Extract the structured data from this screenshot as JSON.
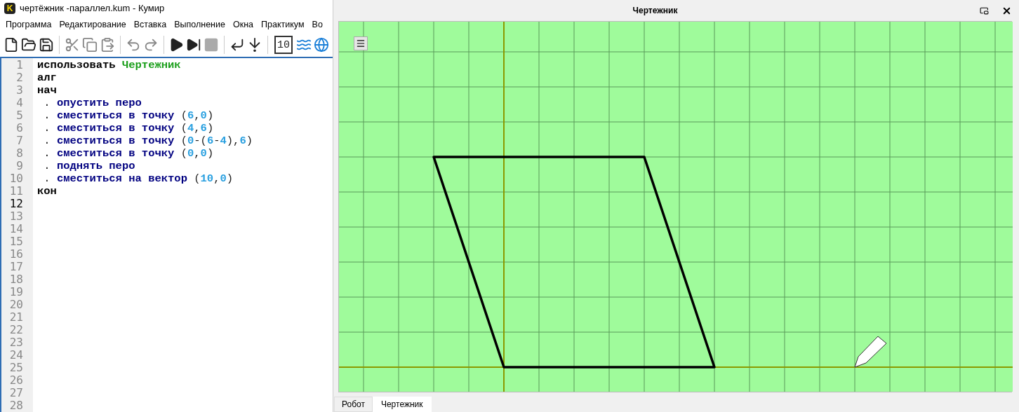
{
  "main_window": {
    "logo": "K",
    "title": "чертёжник -параллел.kum - Кумир"
  },
  "menu": [
    "Программа",
    "Редактирование",
    "Вставка",
    "Выполнение",
    "Окна",
    "Практикум",
    "Во"
  ],
  "toolbar": [
    {
      "kind": "new"
    },
    {
      "kind": "open"
    },
    {
      "kind": "save"
    },
    {
      "kind": "sep"
    },
    {
      "kind": "cut"
    },
    {
      "kind": "copy"
    },
    {
      "kind": "paste"
    },
    {
      "kind": "sep"
    },
    {
      "kind": "undo"
    },
    {
      "kind": "redo"
    },
    {
      "kind": "sep"
    },
    {
      "kind": "run"
    },
    {
      "kind": "step-run"
    },
    {
      "kind": "stop"
    },
    {
      "kind": "sep"
    },
    {
      "kind": "step-over"
    },
    {
      "kind": "step-into"
    },
    {
      "kind": "sep"
    },
    {
      "kind": "counter",
      "text": "10"
    },
    {
      "kind": "waves"
    },
    {
      "kind": "globe"
    }
  ],
  "editor": {
    "lines": [
      {
        "number": "1",
        "selected": false,
        "tokens": [
          {
            "kind": "keyword",
            "text": "использовать"
          },
          {
            "kind": "module",
            "text": "Чертежник"
          }
        ]
      },
      {
        "number": "2",
        "selected": false,
        "tokens": [
          {
            "kind": "keyword",
            "text": "алг"
          }
        ]
      },
      {
        "number": "3",
        "selected": false,
        "tokens": [
          {
            "kind": "keyword",
            "text": "нач"
          }
        ]
      },
      {
        "number": "4",
        "selected": false,
        "tokens": [
          {
            "kind": "plain",
            "text": " . "
          },
          {
            "kind": "command",
            "text": "опустить перо"
          }
        ]
      },
      {
        "number": "5",
        "selected": false,
        "tokens": [
          {
            "kind": "plain",
            "text": " . "
          },
          {
            "kind": "command",
            "text": "сместиться в точку"
          },
          {
            "kind": "plain",
            "text": " ("
          },
          {
            "kind": "number",
            "text": "6"
          },
          {
            "kind": "plain",
            "text": ","
          },
          {
            "kind": "number",
            "text": "0"
          },
          {
            "kind": "plain",
            "text": ")"
          }
        ]
      },
      {
        "number": "6",
        "selected": false,
        "tokens": [
          {
            "kind": "plain",
            "text": " . "
          },
          {
            "kind": "command",
            "text": "сместиться в точку"
          },
          {
            "kind": "plain",
            "text": " ("
          },
          {
            "kind": "number",
            "text": "4"
          },
          {
            "kind": "plain",
            "text": ","
          },
          {
            "kind": "number",
            "text": "6"
          },
          {
            "kind": "plain",
            "text": ")"
          }
        ]
      },
      {
        "number": "7",
        "selected": false,
        "tokens": [
          {
            "kind": "plain",
            "text": " . "
          },
          {
            "kind": "command",
            "text": "сместиться в точку"
          },
          {
            "kind": "plain",
            "text": " ("
          },
          {
            "kind": "number",
            "text": "0"
          },
          {
            "kind": "plain",
            "text": "-("
          },
          {
            "kind": "number",
            "text": "6"
          },
          {
            "kind": "plain",
            "text": "-"
          },
          {
            "kind": "number",
            "text": "4"
          },
          {
            "kind": "plain",
            "text": "),"
          },
          {
            "kind": "number",
            "text": "6"
          },
          {
            "kind": "plain",
            "text": ")"
          }
        ]
      },
      {
        "number": "8",
        "selected": false,
        "tokens": [
          {
            "kind": "plain",
            "text": " . "
          },
          {
            "kind": "command",
            "text": "сместиться в точку"
          },
          {
            "kind": "plain",
            "text": " ("
          },
          {
            "kind": "number",
            "text": "0"
          },
          {
            "kind": "plain",
            "text": ","
          },
          {
            "kind": "number",
            "text": "0"
          },
          {
            "kind": "plain",
            "text": ")"
          }
        ]
      },
      {
        "number": "9",
        "selected": false,
        "tokens": [
          {
            "kind": "plain",
            "text": " . "
          },
          {
            "kind": "command",
            "text": "поднять перо"
          }
        ]
      },
      {
        "number": "10",
        "selected": false,
        "tokens": [
          {
            "kind": "plain",
            "text": " . "
          },
          {
            "kind": "command",
            "text": "сместиться на вектор"
          },
          {
            "kind": "plain",
            "text": " ("
          },
          {
            "kind": "number",
            "text": "10"
          },
          {
            "kind": "plain",
            "text": ","
          },
          {
            "kind": "number",
            "text": "0"
          },
          {
            "kind": "plain",
            "text": ")"
          }
        ]
      },
      {
        "number": "11",
        "selected": false,
        "tokens": [
          {
            "kind": "keyword",
            "text": "кон"
          }
        ]
      },
      {
        "number": "12",
        "selected": true
      },
      {
        "number": "13",
        "selected": false
      },
      {
        "number": "14",
        "selected": false
      },
      {
        "number": "15",
        "selected": false
      },
      {
        "number": "16",
        "selected": false
      },
      {
        "number": "17",
        "selected": false
      },
      {
        "number": "18",
        "selected": false
      },
      {
        "number": "19",
        "selected": false
      },
      {
        "number": "20",
        "selected": false
      },
      {
        "number": "21",
        "selected": false
      },
      {
        "number": "22",
        "selected": false
      },
      {
        "number": "23",
        "selected": false
      },
      {
        "number": "24",
        "selected": false
      },
      {
        "number": "25",
        "selected": false
      },
      {
        "number": "26",
        "selected": false
      },
      {
        "number": "27",
        "selected": false
      },
      {
        "number": "28",
        "selected": false
      }
    ]
  },
  "drawer_window": {
    "title": "Чертежник",
    "tabs": [
      {
        "label": "Робот",
        "selected": false
      },
      {
        "label": "Чертежник",
        "selected": true
      }
    ]
  }
}
